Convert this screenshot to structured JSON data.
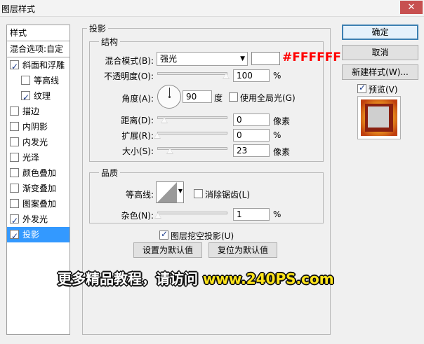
{
  "window": {
    "title": "图层样式",
    "close_label": "✕"
  },
  "left_panel": {
    "header": "样式",
    "blend_options": "混合选项:自定",
    "items": [
      {
        "label": "斜面和浮雕",
        "checked": true,
        "indent": 0
      },
      {
        "label": "等高线",
        "checked": false,
        "indent": 1
      },
      {
        "label": "纹理",
        "checked": true,
        "indent": 1
      },
      {
        "label": "描边",
        "checked": false,
        "indent": 0
      },
      {
        "label": "内阴影",
        "checked": false,
        "indent": 0
      },
      {
        "label": "内发光",
        "checked": false,
        "indent": 0
      },
      {
        "label": "光泽",
        "checked": false,
        "indent": 0
      },
      {
        "label": "颜色叠加",
        "checked": false,
        "indent": 0
      },
      {
        "label": "渐变叠加",
        "checked": false,
        "indent": 0
      },
      {
        "label": "图案叠加",
        "checked": false,
        "indent": 0
      },
      {
        "label": "外发光",
        "checked": true,
        "indent": 0
      },
      {
        "label": "投影",
        "checked": true,
        "indent": 0,
        "selected": true
      }
    ]
  },
  "main": {
    "section_title": "投影",
    "structure": {
      "title": "结构",
      "blend_mode_label": "混合模式(B):",
      "blend_mode_value": "强光",
      "color_hex_label": "#FFFFFF",
      "opacity_label": "不透明度(O):",
      "opacity_value": "100",
      "opacity_unit": "%",
      "angle_label": "角度(A):",
      "angle_value": "90",
      "angle_unit": "度",
      "global_light_label": "使用全局光(G)",
      "distance_label": "距离(D):",
      "distance_value": "0",
      "distance_unit": "像素",
      "spread_label": "扩展(R):",
      "spread_value": "0",
      "spread_unit": "%",
      "size_label": "大小(S):",
      "size_value": "23",
      "size_unit": "像素"
    },
    "quality": {
      "title": "品质",
      "contour_label": "等高线:",
      "anti_alias_label": "消除锯齿(L)",
      "noise_label": "杂色(N):",
      "noise_value": "1",
      "noise_unit": "%"
    },
    "knockout_label": "图层挖空投影(U)",
    "set_default_button": "设置为默认值",
    "reset_default_button": "复位为默认值"
  },
  "right_panel": {
    "ok_button": "确定",
    "cancel_button": "取消",
    "new_style_button": "新建样式(W)...",
    "preview_label": "预览(V)",
    "preview_checked": true
  },
  "watermark": {
    "text": "更多精品教程，请访问",
    "url": "www.240PS.com"
  },
  "colors": {
    "accent": "#3399ff",
    "hex_annotation": "#ff0000",
    "watermark_url": "#ffe41a",
    "close_button": "#c75050"
  }
}
